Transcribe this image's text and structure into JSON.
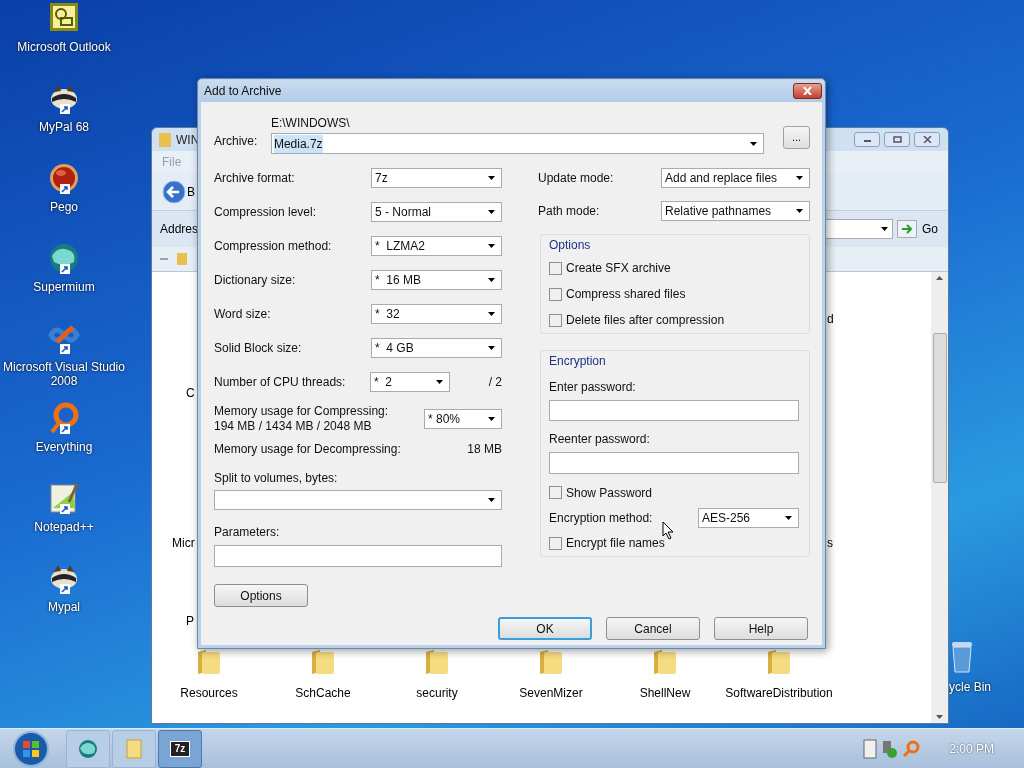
{
  "desktop_icons": [
    {
      "label": "Microsoft Outlook"
    },
    {
      "label": "MyPal 68"
    },
    {
      "label": "Pego"
    },
    {
      "label": "Supermium"
    },
    {
      "label": "Microsoft Visual Studio 2008"
    },
    {
      "label": "Everything"
    },
    {
      "label": "Notepad++"
    },
    {
      "label": "Mypal"
    }
  ],
  "recycle_bin": {
    "label": "ycle Bin"
  },
  "explorer": {
    "title": "WIN",
    "menu": [
      "File"
    ],
    "back_label": "B",
    "address_label": "Addres",
    "go": "Go",
    "fragments": [
      {
        "text": "C"
      },
      {
        "text": "Micr"
      },
      {
        "text": "P"
      },
      {
        "text": "d"
      },
      {
        "text": "s"
      }
    ],
    "folders": [
      {
        "label": "Resources"
      },
      {
        "label": "SchCache"
      },
      {
        "label": "security"
      },
      {
        "label": "SevenMizer"
      },
      {
        "label": "ShellNew"
      },
      {
        "label": "SoftwareDistribution"
      }
    ]
  },
  "dialog": {
    "title": "Add to Archive",
    "archive_label": "Archive:",
    "archive_path": "E:\\WINDOWS\\",
    "archive_name": "Media.7z",
    "browse": "...",
    "left_fields": [
      {
        "label": "Archive format:",
        "value": "7z"
      },
      {
        "label": "Compression level:",
        "value": "5 - Normal"
      },
      {
        "label": "Compression method:",
        "value": "*  LZMA2"
      },
      {
        "label": "Dictionary size:",
        "value": "*  16 MB"
      },
      {
        "label": "Word size:",
        "value": "*  32"
      },
      {
        "label": "Solid Block size:",
        "value": "*  4 GB"
      }
    ],
    "threads": {
      "label": "Number of CPU threads:",
      "value": "*  2",
      "max": "/ 2"
    },
    "memory_compress": {
      "label": "Memory usage for Compressing:",
      "detail": "194 MB / 1434 MB / 2048 MB",
      "value": "* 80%"
    },
    "memory_decompress": {
      "label": "Memory usage for Decompressing:",
      "value": "18 MB"
    },
    "split": {
      "label": "Split to volumes, bytes:"
    },
    "parameters": {
      "label": "Parameters:"
    },
    "options_button": "Options",
    "right_fields": [
      {
        "label": "Update mode:",
        "value": "Add and replace files"
      },
      {
        "label": "Path mode:",
        "value": "Relative pathnames"
      }
    ],
    "options_group": {
      "title": "Options",
      "checkboxes": [
        {
          "label": "Create SFX archive",
          "checked": false
        },
        {
          "label": "Compress shared files",
          "checked": false
        },
        {
          "label": "Delete files after compression",
          "checked": false
        }
      ]
    },
    "encryption": {
      "title": "Encryption",
      "enter_label": "Enter password:",
      "reenter_label": "Reenter password:",
      "show_password": {
        "label": "Show Password",
        "checked": false
      },
      "method_label": "Encryption method:",
      "method": "AES-256",
      "encrypt_names": {
        "label": "Encrypt file names",
        "checked": false
      }
    },
    "buttons": [
      {
        "label": "OK",
        "default": true
      },
      {
        "label": "Cancel",
        "default": false
      },
      {
        "label": "Help",
        "default": false
      }
    ]
  },
  "taskbar": {
    "items": [
      {
        "selected": false
      },
      {
        "selected": false
      },
      {
        "label": "7z",
        "selected": true
      }
    ],
    "clock": "2:00 PM"
  }
}
